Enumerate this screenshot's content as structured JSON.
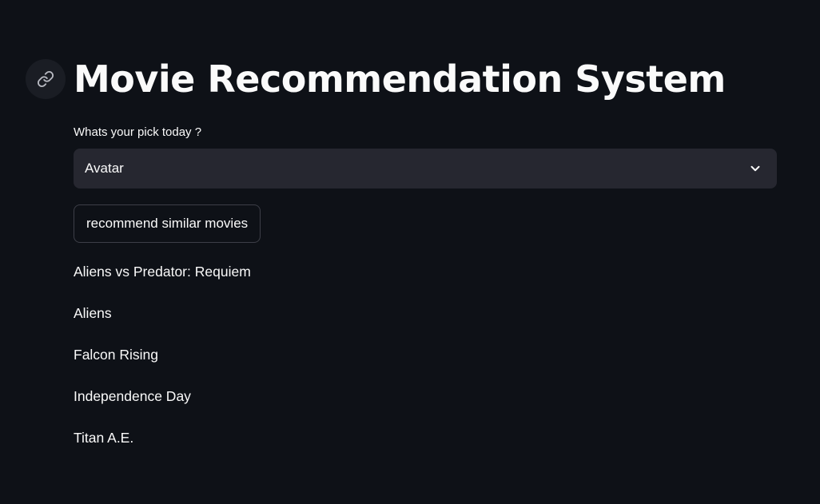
{
  "header": {
    "title": "Movie Recommendation System",
    "anchor_icon": "link-icon"
  },
  "picker": {
    "label": "Whats your pick today ?",
    "selected": "Avatar",
    "dropdown_icon": "chevron-down-icon"
  },
  "action": {
    "button_label": "recommend similar movies"
  },
  "recommendations": [
    "Aliens vs Predator: Requiem",
    "Aliens",
    "Falcon Rising",
    "Independence Day",
    "Titan A.E."
  ],
  "colors": {
    "background": "#0e1117",
    "text": "#fafafa",
    "select_bg": "#262730",
    "button_border": "#3d3f48"
  }
}
